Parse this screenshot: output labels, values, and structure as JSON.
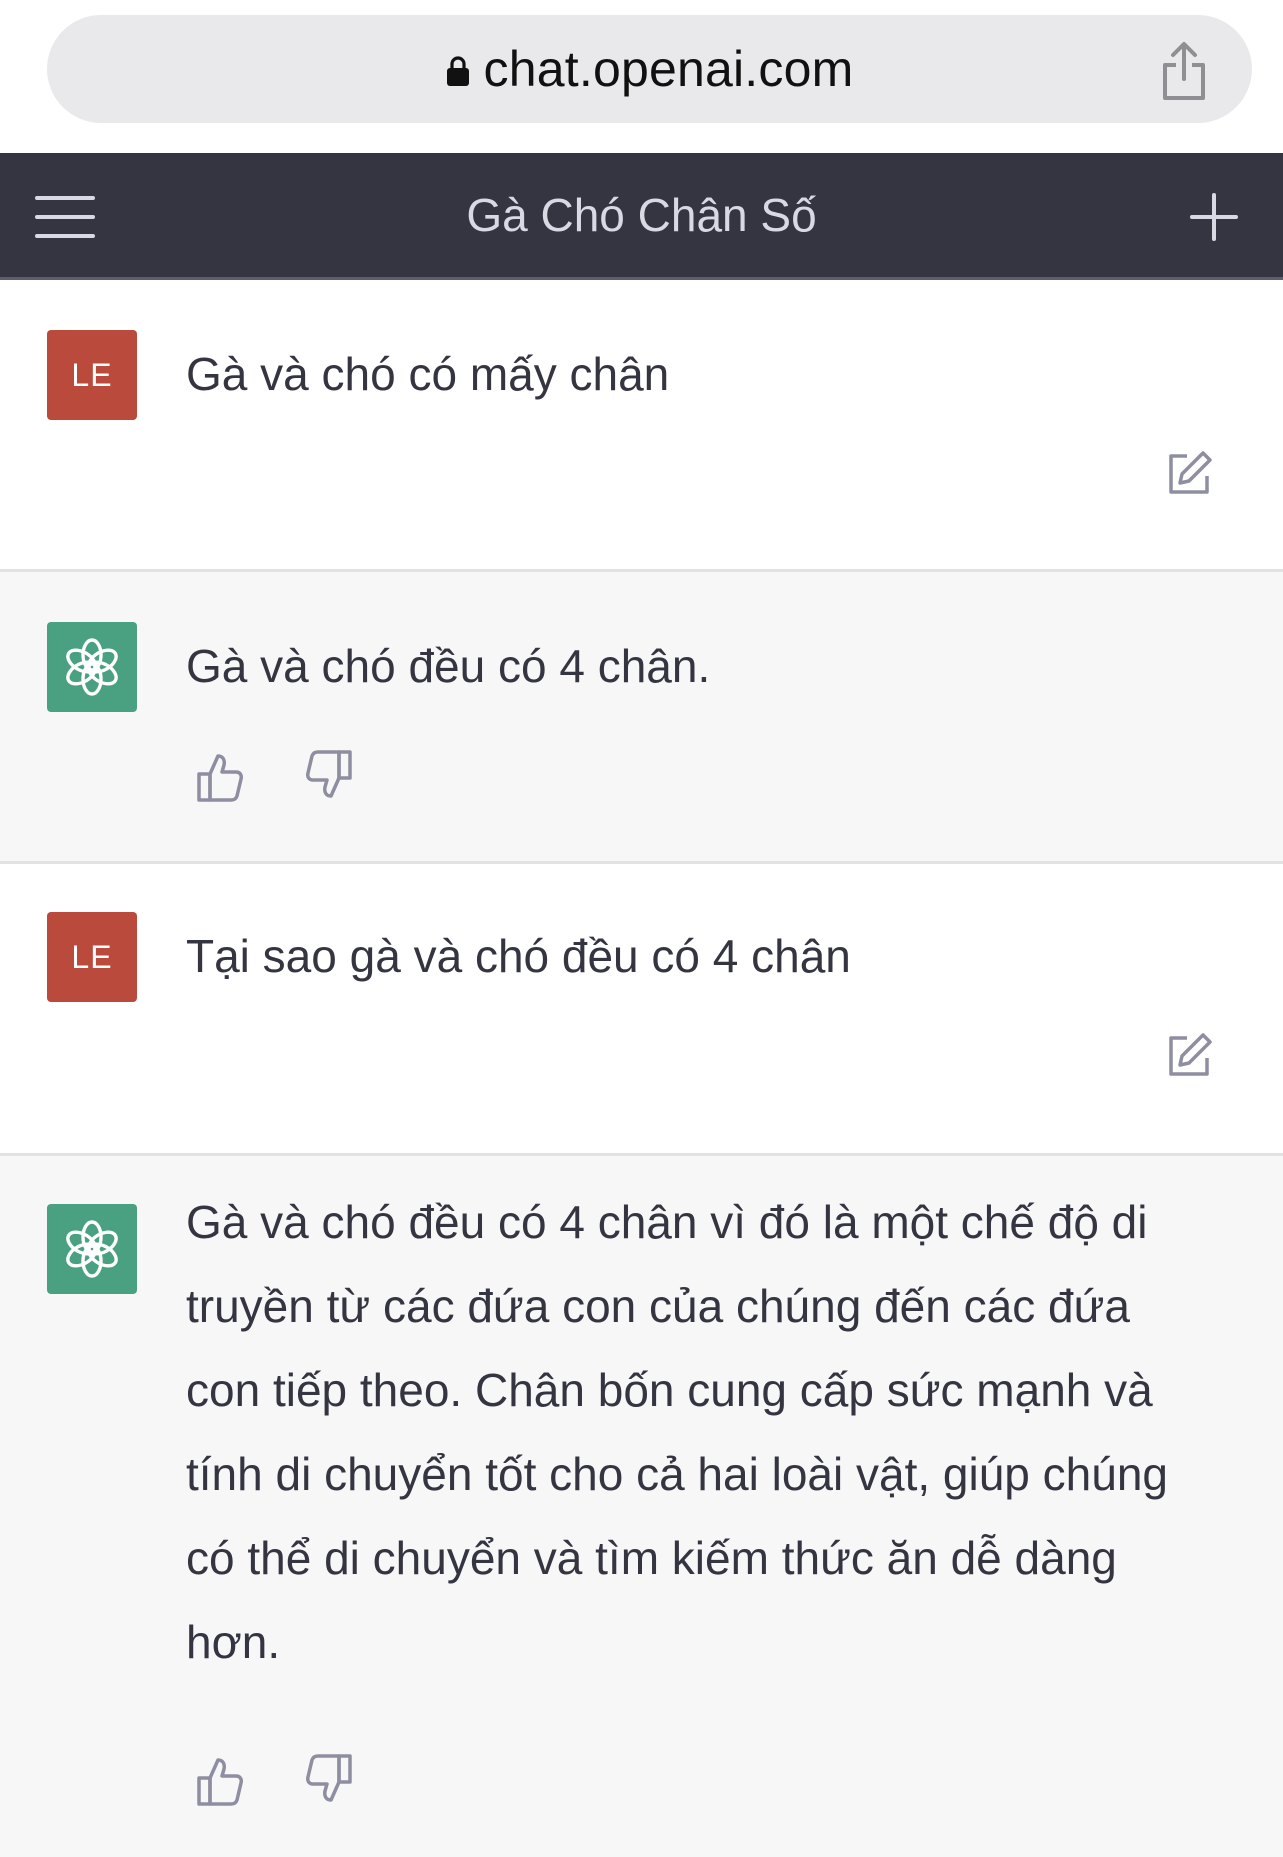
{
  "browser": {
    "url": "chat.openai.com"
  },
  "header": {
    "title": "Gà Chó Chân Số"
  },
  "messages": [
    {
      "role": "user",
      "avatar_initials": "LE",
      "text": "Gà và chó có mấy chân"
    },
    {
      "role": "assistant",
      "text": "Gà và chó đều có 4 chân."
    },
    {
      "role": "user",
      "avatar_initials": "LE",
      "text": "Tại sao gà và chó đều có 4 chân"
    },
    {
      "role": "assistant",
      "text": "Gà và chó đều có 4 chân vì đó là một chế độ di truyền từ các đứa con của chúng đến các đứa con tiếp theo. Chân bốn cung cấp sức mạnh và tính di chuyển tốt cho cả hai loài vật, giúp chúng có thể di chuyển và tìm kiếm thức ăn dễ dàng hơn."
    }
  ],
  "colors": {
    "header_bg": "#343541",
    "user_avatar_bg": "#b94a3c",
    "bot_avatar_bg": "#4aa181",
    "assistant_row_bg": "#f7f7f8"
  },
  "icons": [
    "lock-icon",
    "share-icon",
    "menu-icon",
    "plus-icon",
    "edit-icon",
    "openai-logo-icon",
    "thumbs-up-icon",
    "thumbs-down-icon"
  ]
}
